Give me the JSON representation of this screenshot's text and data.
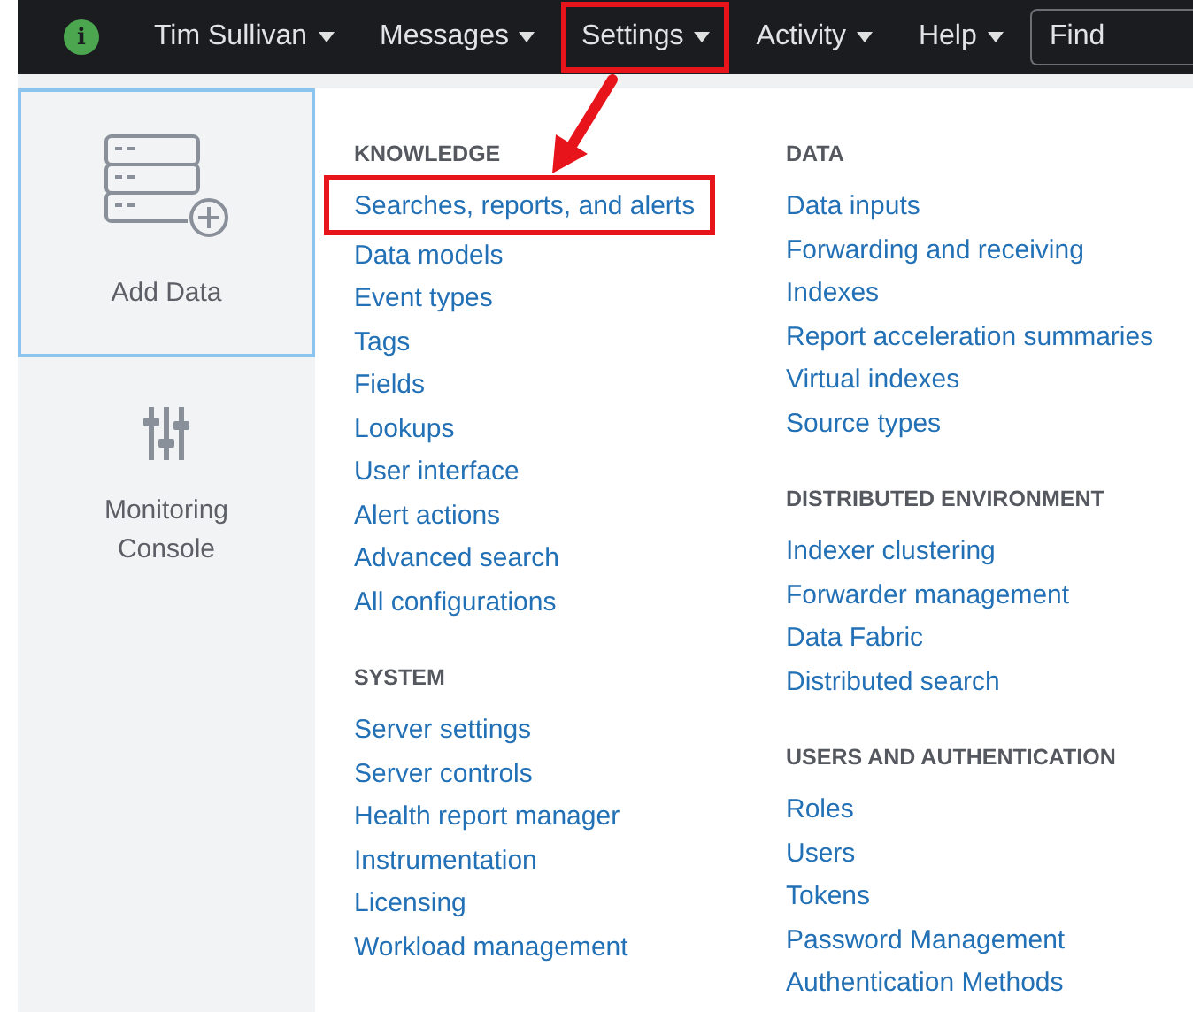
{
  "top_bar": {
    "status": "i",
    "items": [
      {
        "label": "Tim Sullivan",
        "highlighted": false
      },
      {
        "label": "Messages",
        "highlighted": false
      },
      {
        "label": "Settings",
        "highlighted": true
      },
      {
        "label": "Activity",
        "highlighted": false
      },
      {
        "label": "Help",
        "highlighted": false
      }
    ],
    "search": {
      "placeholder": "Find"
    }
  },
  "sidebar": {
    "tiles": [
      {
        "label": "Add Data",
        "kind": "database",
        "selected": true
      },
      {
        "label": "Monitoring Console",
        "kind": "sliders",
        "selected": false
      }
    ]
  },
  "menu": {
    "columns": [
      [
        {
          "heading": "KNOWLEDGE",
          "items": [
            {
              "label": "Searches, reports, and alerts",
              "highlighted": true
            },
            {
              "label": "Data models",
              "highlighted": false
            },
            {
              "label": "Event types",
              "highlighted": false
            },
            {
              "label": "Tags",
              "highlighted": false
            },
            {
              "label": "Fields",
              "highlighted": false
            },
            {
              "label": "Lookups",
              "highlighted": false
            },
            {
              "label": "User interface",
              "highlighted": false
            },
            {
              "label": "Alert actions",
              "highlighted": false
            },
            {
              "label": "Advanced search",
              "highlighted": false
            },
            {
              "label": "All configurations",
              "highlighted": false
            }
          ]
        },
        {
          "heading": "SYSTEM",
          "items": [
            {
              "label": "Server settings",
              "highlighted": false
            },
            {
              "label": "Server controls",
              "highlighted": false
            },
            {
              "label": "Health report manager",
              "highlighted": false
            },
            {
              "label": "Instrumentation",
              "highlighted": false
            },
            {
              "label": "Licensing",
              "highlighted": false
            },
            {
              "label": "Workload management",
              "highlighted": false
            }
          ]
        }
      ],
      [
        {
          "heading": "DATA",
          "items": [
            {
              "label": "Data inputs",
              "highlighted": false
            },
            {
              "label": "Forwarding and receiving",
              "highlighted": false
            },
            {
              "label": "Indexes",
              "highlighted": false
            },
            {
              "label": "Report acceleration summaries",
              "highlighted": false
            },
            {
              "label": "Virtual indexes",
              "highlighted": false
            },
            {
              "label": "Source types",
              "highlighted": false
            }
          ]
        },
        {
          "heading": "DISTRIBUTED ENVIRONMENT",
          "items": [
            {
              "label": "Indexer clustering",
              "highlighted": false
            },
            {
              "label": "Forwarder management",
              "highlighted": false
            },
            {
              "label": "Data Fabric",
              "highlighted": false
            },
            {
              "label": "Distributed search",
              "highlighted": false
            }
          ]
        },
        {
          "heading": "USERS AND AUTHENTICATION",
          "items": [
            {
              "label": "Roles",
              "highlighted": false
            },
            {
              "label": "Users",
              "highlighted": false
            },
            {
              "label": "Tokens",
              "highlighted": false
            },
            {
              "label": "Password Management",
              "highlighted": false
            },
            {
              "label": "Authentication Methods",
              "highlighted": false
            }
          ]
        }
      ]
    ]
  },
  "annotation": {
    "arrow": true
  }
}
